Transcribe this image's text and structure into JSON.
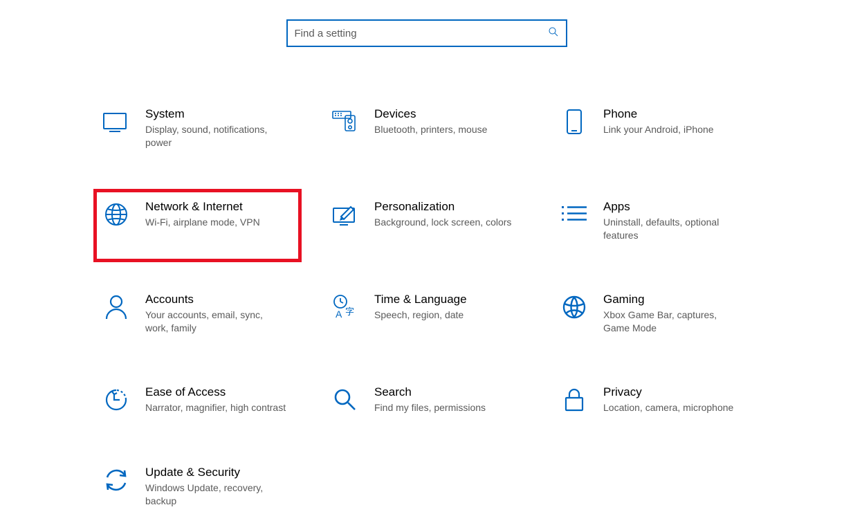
{
  "search": {
    "placeholder": "Find a setting"
  },
  "categories": [
    {
      "id": "system",
      "title": "System",
      "desc": "Display, sound, notifications, power"
    },
    {
      "id": "devices",
      "title": "Devices",
      "desc": "Bluetooth, printers, mouse"
    },
    {
      "id": "phone",
      "title": "Phone",
      "desc": "Link your Android, iPhone"
    },
    {
      "id": "network",
      "title": "Network & Internet",
      "desc": "Wi-Fi, airplane mode, VPN",
      "highlighted": true
    },
    {
      "id": "personalization",
      "title": "Personalization",
      "desc": "Background, lock screen, colors"
    },
    {
      "id": "apps",
      "title": "Apps",
      "desc": "Uninstall, defaults, optional features"
    },
    {
      "id": "accounts",
      "title": "Accounts",
      "desc": "Your accounts, email, sync, work, family"
    },
    {
      "id": "time",
      "title": "Time & Language",
      "desc": "Speech, region, date"
    },
    {
      "id": "gaming",
      "title": "Gaming",
      "desc": "Xbox Game Bar, captures, Game Mode"
    },
    {
      "id": "ease",
      "title": "Ease of Access",
      "desc": "Narrator, magnifier, high contrast"
    },
    {
      "id": "search",
      "title": "Search",
      "desc": "Find my files, permissions"
    },
    {
      "id": "privacy",
      "title": "Privacy",
      "desc": "Location, camera, microphone"
    },
    {
      "id": "update",
      "title": "Update & Security",
      "desc": "Windows Update, recovery, backup"
    }
  ],
  "colors": {
    "accent": "#0067c0",
    "highlight_border": "#e81123"
  }
}
